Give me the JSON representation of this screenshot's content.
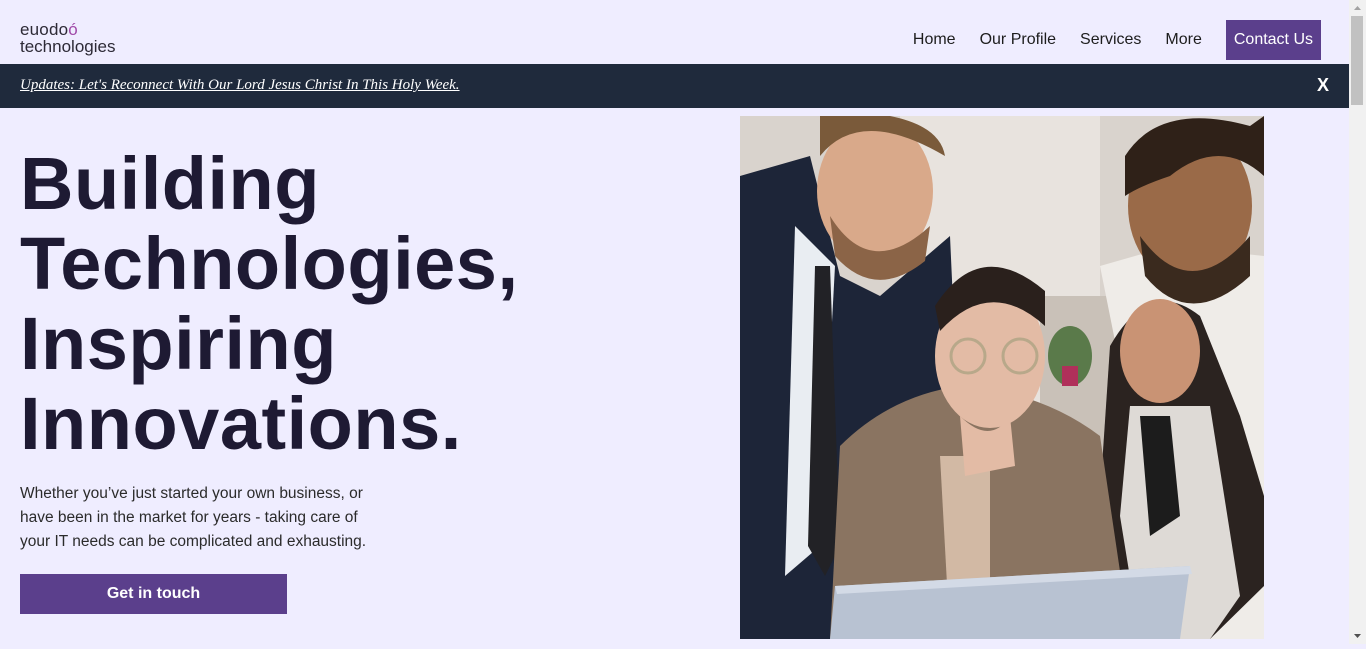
{
  "logo": {
    "line1_main": "euodo",
    "line1_accent": "ó",
    "line2": "technologies"
  },
  "nav": {
    "items": [
      {
        "label": "Home"
      },
      {
        "label": "Our Profile"
      },
      {
        "label": "Services"
      },
      {
        "label": "More"
      }
    ],
    "cta_label": "Contact Us"
  },
  "announcement": {
    "text": "Updates: Let's Reconnect With Our Lord Jesus Christ In This Holy Week.",
    "close_label": "X"
  },
  "hero": {
    "title_lines": [
      "Building",
      "Technologies,",
      "Inspiring",
      "Innovations."
    ],
    "description": "Whether you’ve just started your own business, or have been in the market for years - taking care of your IT needs can be complicated and exhausting.",
    "button_label": "Get in touch"
  },
  "colors": {
    "page_background": "#efedff",
    "brand_purple": "#5b3f8c",
    "announcement_bar": "#1f2a3c",
    "title_text": "#1e1a33",
    "logo_accent": "#a04aa8"
  }
}
